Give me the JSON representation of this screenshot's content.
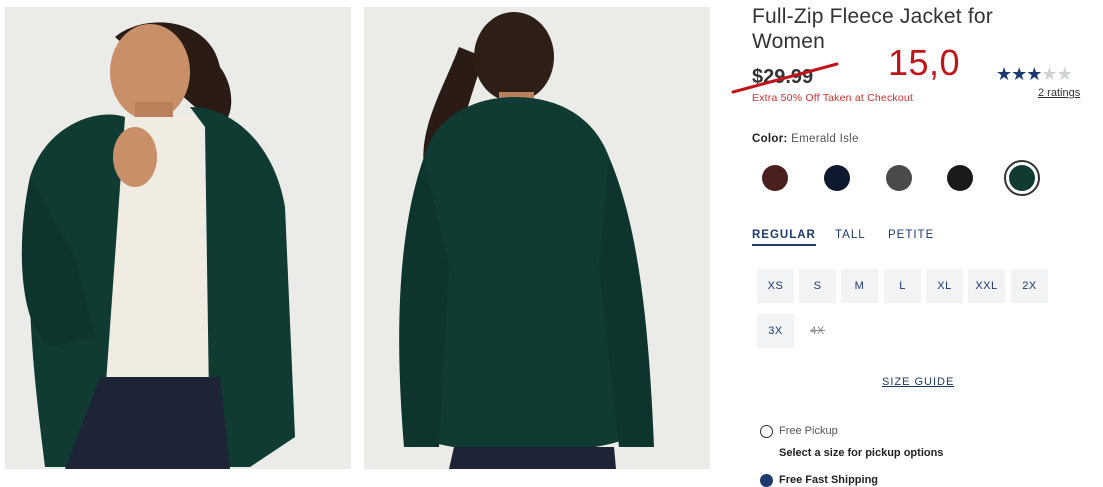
{
  "product": {
    "title": "Full-Zip Fleece Jacket for Women",
    "old_price": "$29.99",
    "promo": "Extra 50% Off Taken at Checkout",
    "annotated_price": "15,0",
    "rating": 3,
    "rating_max": 5,
    "ratings_link": "2 ratings"
  },
  "color": {
    "label": "Color:",
    "selected": "Emerald Isle",
    "swatches": [
      {
        "name": "burgundy",
        "hex": "#4a1f1e"
      },
      {
        "name": "navy",
        "hex": "#0d1a2e"
      },
      {
        "name": "charcoal",
        "hex": "#4a4a4a"
      },
      {
        "name": "black",
        "hex": "#1a1a1a"
      },
      {
        "name": "emerald-isle",
        "hex": "#0f3b33"
      }
    ]
  },
  "fit_tabs": [
    "REGULAR",
    "TALL",
    "PETITE"
  ],
  "sizes": [
    "XS",
    "S",
    "M",
    "L",
    "XL",
    "XXL",
    "2X",
    "3X",
    "4X"
  ],
  "size_guide": "SIZE GUIDE",
  "fulfillment": {
    "pickup_label": "Free Pickup",
    "pickup_sub": "Select a size for pickup options",
    "shipping_label": "Free Fast Shipping"
  },
  "colors": {
    "navy": "#1d3a6e",
    "promo_red": "#d0312d",
    "annotation_red": "#c0141a",
    "jacket_green": "#0f3b33"
  }
}
